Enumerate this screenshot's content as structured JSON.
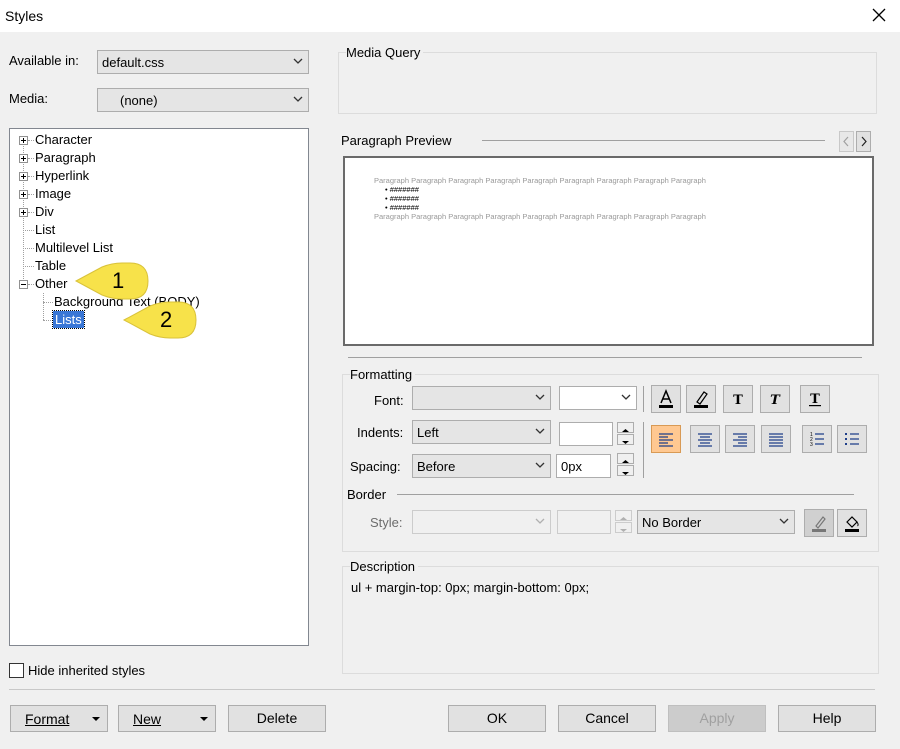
{
  "window": {
    "title": "Styles"
  },
  "available_in": {
    "label": "Available in:",
    "value": "default.css"
  },
  "media": {
    "label": "Media:",
    "value": "(none)"
  },
  "tree": {
    "items": [
      {
        "label": "Character"
      },
      {
        "label": "Paragraph"
      },
      {
        "label": "Hyperlink"
      },
      {
        "label": "Image"
      },
      {
        "label": "Div"
      },
      {
        "label": "List"
      },
      {
        "label": "Multilevel List"
      },
      {
        "label": "Table"
      },
      {
        "label": "Other"
      },
      {
        "label": "Background Text (BODY)"
      },
      {
        "label": "Lists"
      }
    ]
  },
  "callouts": {
    "one": "1",
    "two": "2",
    "color": "#f7e24a"
  },
  "hide_inherited": {
    "label": "Hide inherited styles",
    "checked": false
  },
  "media_query": {
    "label": "Media Query"
  },
  "preview": {
    "label": "Paragraph Preview",
    "para": "Paragraph Paragraph Paragraph Paragraph Paragraph Paragraph Paragraph Paragraph Paragraph",
    "bullets": [
      "#######",
      "#######",
      "#######"
    ]
  },
  "formatting": {
    "label": "Formatting",
    "font_label": "Font:",
    "font_value": "",
    "size_value": "",
    "indents_label": "Indents:",
    "indents_value": "Left",
    "indents_amount": "",
    "spacing_label": "Spacing:",
    "spacing_value": "Before",
    "spacing_amount": "0px"
  },
  "border": {
    "label": "Border",
    "style_label": "Style:",
    "style_value": "",
    "width_value": "",
    "type_value": "No Border"
  },
  "description": {
    "label": "Description",
    "text": "ul +  margin-top: 0px;  margin-bottom: 0px;"
  },
  "buttons": {
    "format": "Format",
    "new": "New",
    "delete": "Delete",
    "ok": "OK",
    "cancel": "Cancel",
    "apply": "Apply",
    "help": "Help"
  },
  "colors": {
    "selection": "#3a77d6",
    "accent_button": "#ffc891"
  }
}
